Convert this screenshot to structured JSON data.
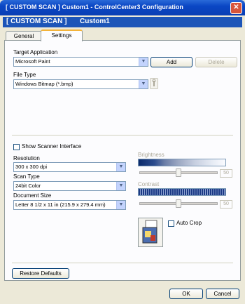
{
  "window": {
    "title": "[  CUSTOM SCAN  ]   Custom1 - ControlCenter3 Configuration"
  },
  "banner": {
    "left": "[ CUSTOM SCAN ]",
    "right": "Custom1"
  },
  "tabs": [
    {
      "label": "General"
    },
    {
      "label": "Settings"
    }
  ],
  "target_app": {
    "label": "Target Application",
    "value": "Microsoft Paint",
    "add": "Add",
    "delete": "Delete"
  },
  "file_type": {
    "label": "File Type",
    "value": "Windows Bitmap (*.bmp)"
  },
  "scanner_interface": {
    "label": "Show Scanner Interface"
  },
  "resolution": {
    "label": "Resolution",
    "value": "300 x 300 dpi"
  },
  "scan_type": {
    "label": "Scan Type",
    "value": "24bit Color"
  },
  "document_size": {
    "label": "Document Size",
    "value": "Letter 8 1/2 x 11 in (215.9 x 279.4 mm)"
  },
  "brightness": {
    "label": "Brightness",
    "value": "50",
    "level": 0.5
  },
  "contrast": {
    "label": "Contrast",
    "value": "50",
    "level": 0.5
  },
  "auto_crop": {
    "label": "Auto Crop"
  },
  "restore": {
    "label": "Restore Defaults"
  },
  "footer": {
    "ok": "OK",
    "cancel": "Cancel"
  },
  "colors": {
    "title_blue": "#0a46c4",
    "banner_blue": "#1d55b8",
    "tab_highlight": "#f3b33a"
  }
}
